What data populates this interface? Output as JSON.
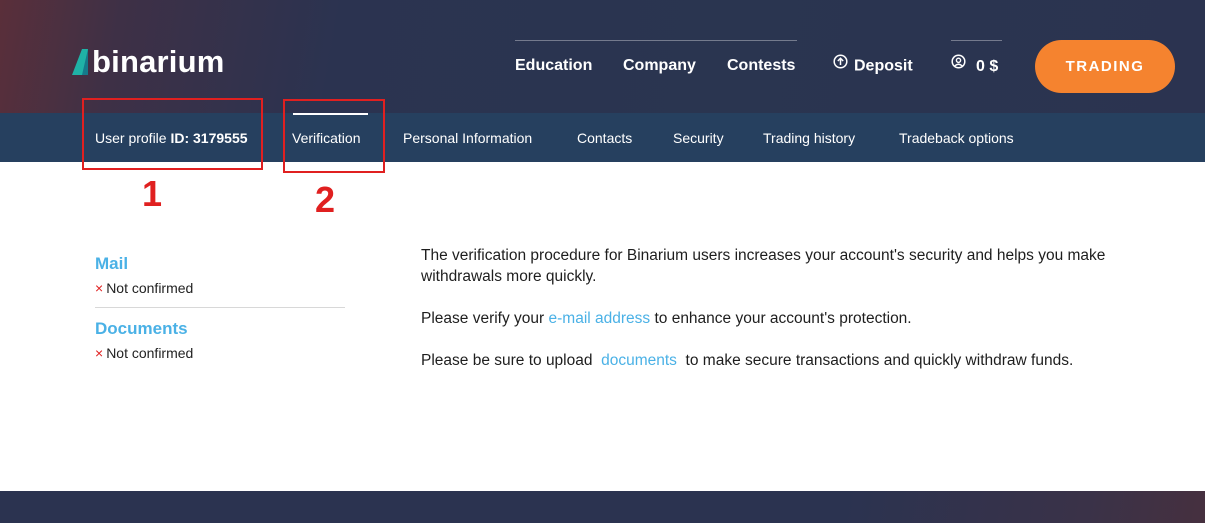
{
  "header": {
    "logo_text": "binarium",
    "nav": [
      {
        "label": "Education"
      },
      {
        "label": "Company"
      },
      {
        "label": "Contests"
      }
    ],
    "deposit_label": "Deposit",
    "balance": "0 $",
    "trading_button": "TRADING"
  },
  "subnav": {
    "profile_prefix": "User profile ",
    "profile_id": "ID: 3179555",
    "items": [
      {
        "label": "Verification",
        "active": true
      },
      {
        "label": "Personal Information"
      },
      {
        "label": "Contacts"
      },
      {
        "label": "Security"
      },
      {
        "label": "Trading history"
      },
      {
        "label": "Tradeback options"
      }
    ]
  },
  "annotations": [
    {
      "label": "1"
    },
    {
      "label": "2"
    }
  ],
  "sidebar": {
    "sections": [
      {
        "title": "Mail",
        "status_mark": "×",
        "status": "Not confirmed"
      },
      {
        "title": "Documents",
        "status_mark": "×",
        "status": "Not confirmed"
      }
    ]
  },
  "main": {
    "para1": "The verification procedure for Binarium users increases your account's security and helps you make withdrawals more quickly.",
    "para2_before": "Please verify your ",
    "para2_link": "e-mail address",
    "para2_after": " to enhance your account's protection.",
    "para3_before": "Please be sure to upload ",
    "para3_link": "documents",
    "para3_after": " to make secure transactions and quickly withdraw funds."
  },
  "colors": {
    "accent_orange": "#f5832f",
    "link_blue": "#4ab1e6",
    "subnav_bg": "#26405f",
    "annotation_red": "#e02020"
  }
}
